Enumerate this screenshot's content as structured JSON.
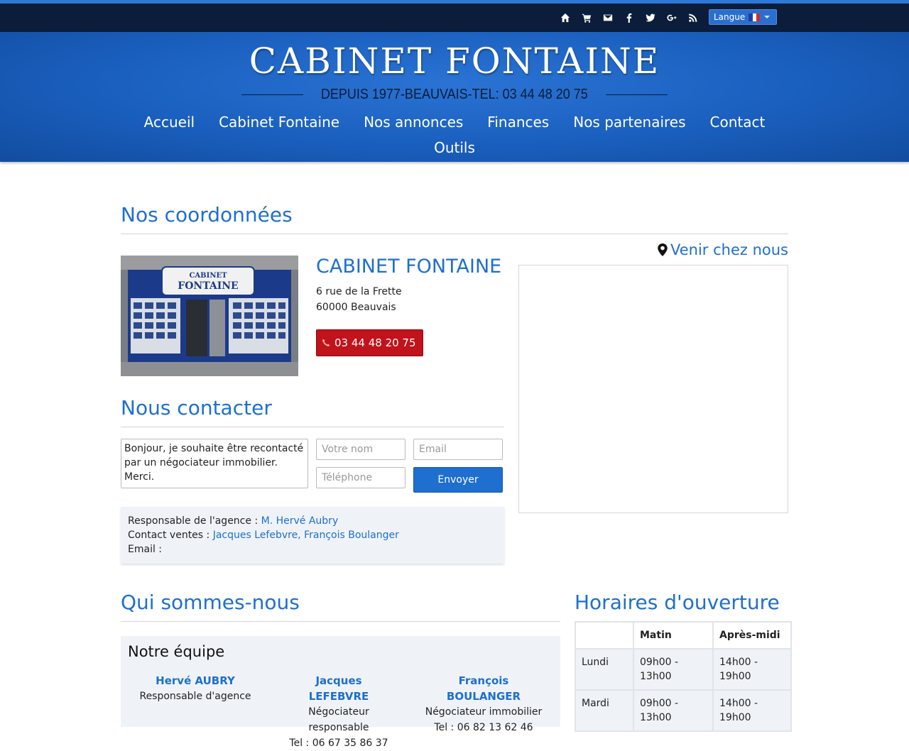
{
  "topbar": {
    "icons": [
      "home-icon",
      "cart-icon",
      "mail-icon",
      "facebook-icon",
      "twitter-icon",
      "google-plus-icon",
      "rss-icon"
    ],
    "language_label": "Langue"
  },
  "header": {
    "brand": "CABINET FONTAINE",
    "tagline": "DEPUIS 1977-BEAUVAIS-TEL: 03 44 48 20 75",
    "nav": [
      "Accueil",
      "Cabinet Fontaine",
      "Nos annonces",
      "Finances",
      "Nos partenaires",
      "Contact",
      "Outils"
    ]
  },
  "coordonnees": {
    "title": "Nos coordonnées",
    "agency_name": "CABINET FONTAINE",
    "street": "6 rue de la Frette",
    "city": "60000 Beauvais",
    "phone": "03 44 48 20 75",
    "venir_label": "Venir chez nous",
    "storefront_sign": [
      "CABINET",
      "FONTAINE"
    ]
  },
  "contact": {
    "title": "Nous contacter",
    "message": "Bonjour, je souhaite être recontacté par un négociateur immobilier. Merci.",
    "name_placeholder": "Votre nom",
    "email_placeholder": "Email",
    "phone_placeholder": "Téléphone",
    "send_label": "Envoyer",
    "responsable_label": "Responsable de l'agence : ",
    "responsable_value": "M. Hervé Aubry",
    "ventes_label": "Contact ventes : ",
    "ventes_value": "Jacques Lefebvre, François Boulanger",
    "email_label": "Email :"
  },
  "about": {
    "title": "Qui sommes-nous",
    "team_title": "Notre équipe",
    "members": [
      {
        "name": "Hervé AUBRY",
        "role": "Responsable d'agence",
        "tel": ""
      },
      {
        "name": "Jacques LEFEBVRE",
        "role": "Négociateur responsable",
        "tel": "Tel : 06 67 35 86 37"
      },
      {
        "name": "François BOULANGER",
        "role": "Négociateur immobilier",
        "tel": "Tel : 06 82 13 62 46"
      }
    ]
  },
  "hours": {
    "title": "Horaires d'ouverture",
    "headers": [
      "",
      "Matin",
      "Après-midi"
    ],
    "rows": [
      {
        "day": "Lundi",
        "matin": "09h00 - 13h00",
        "apres": "14h00 - 19h00"
      },
      {
        "day": "Mardi",
        "matin": "09h00 - 13h00",
        "apres": "14h00 - 19h00"
      }
    ]
  },
  "colors": {
    "accent": "#1e6fcf",
    "topbar": "#0b1d3a",
    "phone_button": "#c0131b",
    "panel": "#eff3f8"
  }
}
